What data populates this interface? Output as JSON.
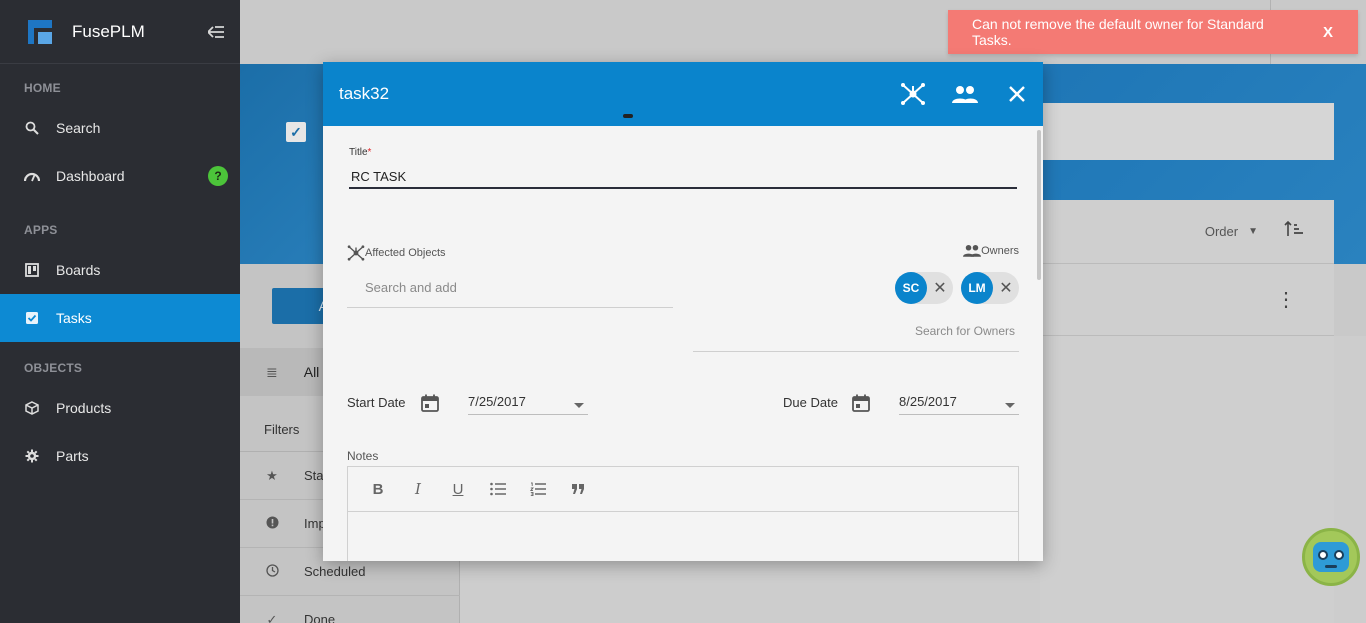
{
  "app": {
    "brand": "FusePLM",
    "collapse_icon": "menu-collapse-icon"
  },
  "sidebar": {
    "sections": [
      {
        "label": "HOME"
      },
      {
        "label": "APPS"
      },
      {
        "label": "OBJECTS"
      }
    ],
    "items": [
      {
        "label": "Search",
        "icon": "search-icon"
      },
      {
        "label": "Dashboard",
        "icon": "dashboard-icon",
        "badge": "?"
      },
      {
        "label": "Boards",
        "icon": "boards-icon"
      },
      {
        "label": "Tasks",
        "icon": "tasks-icon",
        "active": true
      },
      {
        "label": "Products",
        "icon": "cube-icon"
      },
      {
        "label": "Parts",
        "icon": "gear-icon"
      }
    ]
  },
  "background": {
    "add_button_label": "A",
    "all_label": "All",
    "filters_label": "Filters",
    "filter_items": [
      {
        "label": "Sta",
        "icon": "star-icon"
      },
      {
        "label": "Imp",
        "icon": "alert-icon"
      },
      {
        "label": "Scheduled",
        "icon": "clock-icon"
      },
      {
        "label": "Done",
        "icon": "check-icon"
      }
    ],
    "order_label": "Order"
  },
  "toast": {
    "message": "Can not remove the default owner for Standard Tasks.",
    "close_label": "X",
    "color": "#f47a74"
  },
  "modal": {
    "title": "task32",
    "header_color": "#0a84cc",
    "title_field": {
      "label": "Title",
      "required_mark": "*",
      "value": "RC TASK"
    },
    "affected_objects": {
      "label": "Affected Objects",
      "placeholder": "Search and add"
    },
    "owners": {
      "label": "Owners",
      "chips": [
        "SC",
        "LM"
      ],
      "placeholder": "Search for Owners"
    },
    "start_date": {
      "label": "Start Date",
      "value": "7/25/2017"
    },
    "due_date": {
      "label": "Due Date",
      "value": "8/25/2017"
    },
    "notes": {
      "label": "Notes",
      "toolbar": [
        "B",
        "I",
        "U"
      ]
    }
  }
}
